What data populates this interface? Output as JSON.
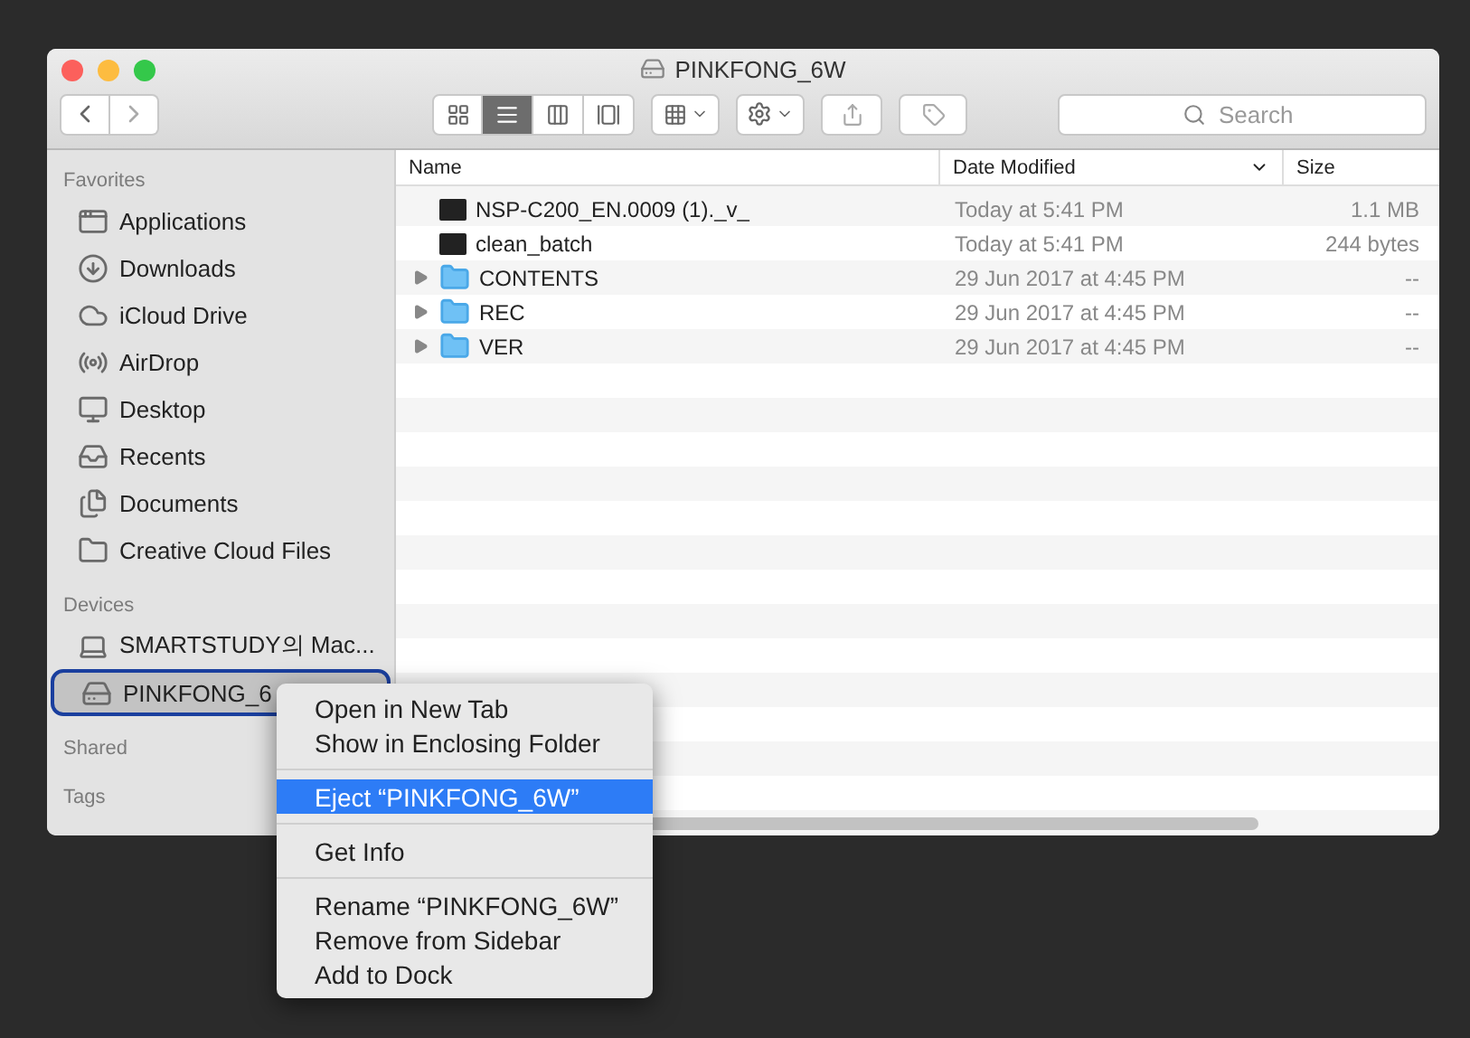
{
  "window": {
    "title": "PINKFONG_6W"
  },
  "toolbar": {
    "views": [
      {
        "kind": "icons",
        "selected": false
      },
      {
        "kind": "list",
        "selected": true
      },
      {
        "kind": "columns",
        "selected": false
      },
      {
        "kind": "gallery",
        "selected": false
      }
    ],
    "search": {
      "placeholder": "Search"
    }
  },
  "sidebar": {
    "sections": [
      {
        "title": "Favorites",
        "items": [
          {
            "label": "Applications",
            "selected": false
          },
          {
            "label": "Downloads",
            "selected": false
          },
          {
            "label": "iCloud Drive",
            "selected": false
          },
          {
            "label": "AirDrop",
            "selected": false
          },
          {
            "label": "Desktop",
            "selected": false
          },
          {
            "label": "Recents",
            "selected": false
          },
          {
            "label": "Documents",
            "selected": false
          },
          {
            "label": "Creative Cloud Files",
            "selected": false
          }
        ]
      },
      {
        "title": "Devices",
        "items": [
          {
            "label": "SMARTSTUDY의 Mac...",
            "selected": false
          },
          {
            "label": "PINKFONG_6",
            "selected": true
          }
        ]
      },
      {
        "title": "Shared"
      },
      {
        "title": "Tags"
      }
    ]
  },
  "table": {
    "columns": [
      {
        "label": "Name",
        "sorted": false
      },
      {
        "label": "Date Modified",
        "sorted": true
      },
      {
        "label": "Size",
        "sorted": false
      }
    ],
    "rows": [
      {
        "kind": "file",
        "name": "NSP-C200_EN.0009 (1)._v_",
        "date": "Today at 5:41 PM",
        "size": "1.1 MB"
      },
      {
        "kind": "file",
        "name": "clean_batch",
        "date": "Today at 5:41 PM",
        "size": "244 bytes"
      },
      {
        "kind": "folder",
        "name": "CONTENTS",
        "date": "29 Jun 2017 at 4:45 PM",
        "size": "--"
      },
      {
        "kind": "folder",
        "name": "REC",
        "date": "29 Jun 2017 at 4:45 PM",
        "size": "--"
      },
      {
        "kind": "folder",
        "name": "VER",
        "date": "29 Jun 2017 at 4:45 PM",
        "size": "--"
      }
    ]
  },
  "context_menu": {
    "groups": [
      [
        {
          "label": "Open in New Tab",
          "selected": false
        },
        {
          "label": "Show in Enclosing Folder",
          "selected": false
        }
      ],
      [
        {
          "label": "Eject “PINKFONG_6W”",
          "selected": true
        }
      ],
      [
        {
          "label": "Get Info",
          "selected": false
        }
      ],
      [
        {
          "label": "Rename “PINKFONG_6W”",
          "selected": false
        },
        {
          "label": "Remove from Sidebar",
          "selected": false
        },
        {
          "label": "Add to Dock",
          "selected": false
        }
      ]
    ]
  }
}
